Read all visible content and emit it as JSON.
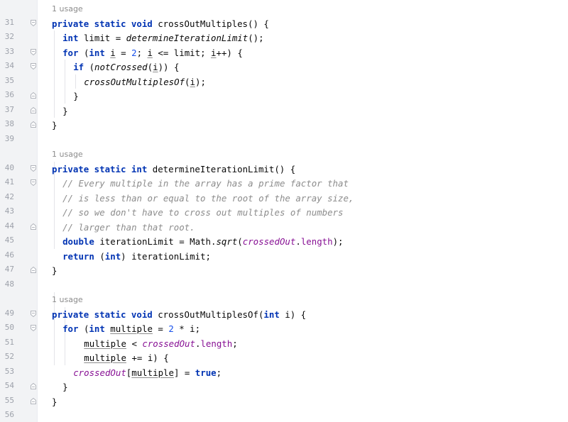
{
  "editor": {
    "usage_label": "1 usage",
    "lines": [
      {
        "type": "usage",
        "text": "1 usage"
      },
      {
        "n": "31",
        "fold": "open",
        "indent": 0,
        "tokens": [
          {
            "t": "private static void ",
            "c": "kw"
          },
          {
            "t": "crossOutMultiples() {"
          }
        ]
      },
      {
        "n": "32",
        "fold": "",
        "indent": 1,
        "tokens": [
          {
            "t": "int ",
            "c": "kw"
          },
          {
            "t": "limit = "
          },
          {
            "t": "determineIterationLimit",
            "c": "it"
          },
          {
            "t": "();"
          }
        ]
      },
      {
        "n": "33",
        "fold": "open",
        "indent": 1,
        "tokens": [
          {
            "t": "for ",
            "c": "kw"
          },
          {
            "t": "("
          },
          {
            "t": "int ",
            "c": "kw"
          },
          {
            "t": "i",
            "c": "ul"
          },
          {
            "t": " = "
          },
          {
            "t": "2",
            "c": "num"
          },
          {
            "t": "; "
          },
          {
            "t": "i",
            "c": "ul"
          },
          {
            "t": " <= limit; "
          },
          {
            "t": "i",
            "c": "ul"
          },
          {
            "t": "++) {"
          }
        ]
      },
      {
        "n": "34",
        "fold": "open",
        "indent": 2,
        "tokens": [
          {
            "t": "if ",
            "c": "kw"
          },
          {
            "t": "("
          },
          {
            "t": "notCrossed",
            "c": "it"
          },
          {
            "t": "("
          },
          {
            "t": "i",
            "c": "ul"
          },
          {
            "t": ")) {"
          }
        ]
      },
      {
        "n": "35",
        "fold": "",
        "indent": 3,
        "tokens": [
          {
            "t": "crossOutMultiplesOf",
            "c": "it"
          },
          {
            "t": "("
          },
          {
            "t": "i",
            "c": "ul"
          },
          {
            "t": ");"
          }
        ]
      },
      {
        "n": "36",
        "fold": "close",
        "indent": 2,
        "tokens": [
          {
            "t": "}"
          }
        ]
      },
      {
        "n": "37",
        "fold": "close",
        "indent": 1,
        "tokens": [
          {
            "t": "}"
          }
        ]
      },
      {
        "n": "38",
        "fold": "close",
        "indent": 0,
        "tokens": [
          {
            "t": "}"
          }
        ]
      },
      {
        "n": "39",
        "fold": "",
        "indent": 0,
        "tokens": []
      },
      {
        "type": "usage",
        "text": "1 usage"
      },
      {
        "n": "40",
        "fold": "open",
        "indent": 0,
        "tokens": [
          {
            "t": "private static int ",
            "c": "kw"
          },
          {
            "t": "determineIterationLimit() {"
          }
        ]
      },
      {
        "n": "41",
        "fold": "open",
        "indent": 1,
        "tokens": [
          {
            "t": "// Every multiple in the array has a prime factor that",
            "c": "cmt"
          }
        ]
      },
      {
        "n": "42",
        "fold": "",
        "indent": 1,
        "tokens": [
          {
            "t": "// is less than or equal to the root of the array size,",
            "c": "cmt"
          }
        ]
      },
      {
        "n": "43",
        "fold": "",
        "indent": 1,
        "tokens": [
          {
            "t": "// so we don't have to cross out multiples of numbers",
            "c": "cmt"
          }
        ]
      },
      {
        "n": "44",
        "fold": "close",
        "indent": 1,
        "tokens": [
          {
            "t": "// larger than that root.",
            "c": "cmt"
          }
        ]
      },
      {
        "n": "45",
        "fold": "",
        "indent": 1,
        "tokens": [
          {
            "t": "double ",
            "c": "kw"
          },
          {
            "t": "iterationLimit = Math."
          },
          {
            "t": "sqrt",
            "c": "it"
          },
          {
            "t": "("
          },
          {
            "t": "crossedOut",
            "c": "fld"
          },
          {
            "t": "."
          },
          {
            "t": "length",
            "c": "fldn"
          },
          {
            "t": ");"
          }
        ]
      },
      {
        "n": "46",
        "fold": "",
        "indent": 1,
        "tokens": [
          {
            "t": "return ",
            "c": "kw"
          },
          {
            "t": "("
          },
          {
            "t": "int",
            "c": "kw"
          },
          {
            "t": ") iterationLimit;"
          }
        ]
      },
      {
        "n": "47",
        "fold": "close",
        "indent": 0,
        "tokens": [
          {
            "t": "}"
          }
        ]
      },
      {
        "n": "48",
        "fold": "",
        "indent": 0,
        "tokens": []
      },
      {
        "type": "usage",
        "text": "1 usage"
      },
      {
        "n": "49",
        "fold": "open",
        "indent": 0,
        "tokens": [
          {
            "t": "private static void ",
            "c": "kw"
          },
          {
            "t": "crossOutMultiplesOf("
          },
          {
            "t": "int ",
            "c": "kw"
          },
          {
            "t": "i) {"
          }
        ]
      },
      {
        "n": "50",
        "fold": "open",
        "indent": 1,
        "tokens": [
          {
            "t": "for ",
            "c": "kw"
          },
          {
            "t": "("
          },
          {
            "t": "int ",
            "c": "kw"
          },
          {
            "t": "multiple",
            "c": "ul"
          },
          {
            "t": " = "
          },
          {
            "t": "2",
            "c": "num"
          },
          {
            "t": " * i;"
          }
        ]
      },
      {
        "n": "51",
        "fold": "",
        "indent": 3,
        "tokens": [
          {
            "t": "multiple",
            "c": "ul"
          },
          {
            "t": " < "
          },
          {
            "t": "crossedOut",
            "c": "fld"
          },
          {
            "t": "."
          },
          {
            "t": "length",
            "c": "fldn"
          },
          {
            "t": ";"
          }
        ]
      },
      {
        "n": "52",
        "fold": "",
        "indent": 3,
        "tokens": [
          {
            "t": "multiple",
            "c": "ul"
          },
          {
            "t": " += i) {"
          }
        ]
      },
      {
        "n": "53",
        "fold": "",
        "indent": 2,
        "tokens": [
          {
            "t": "crossedOut",
            "c": "fld"
          },
          {
            "t": "["
          },
          {
            "t": "multiple",
            "c": "ul"
          },
          {
            "t": "] = "
          },
          {
            "t": "true",
            "c": "kw"
          },
          {
            "t": ";"
          }
        ]
      },
      {
        "n": "54",
        "fold": "close",
        "indent": 1,
        "tokens": [
          {
            "t": "}"
          }
        ]
      },
      {
        "n": "55",
        "fold": "close",
        "indent": 0,
        "tokens": [
          {
            "t": "}"
          }
        ]
      },
      {
        "n": "56",
        "fold": "",
        "indent": 0,
        "tokens": []
      }
    ]
  },
  "colors": {
    "keyword": "#0033b3",
    "field": "#871094",
    "comment": "#8c8c8c",
    "number": "#1750eb",
    "gutter_bg": "#f2f3f5",
    "line_number": "#9ea2ab"
  }
}
